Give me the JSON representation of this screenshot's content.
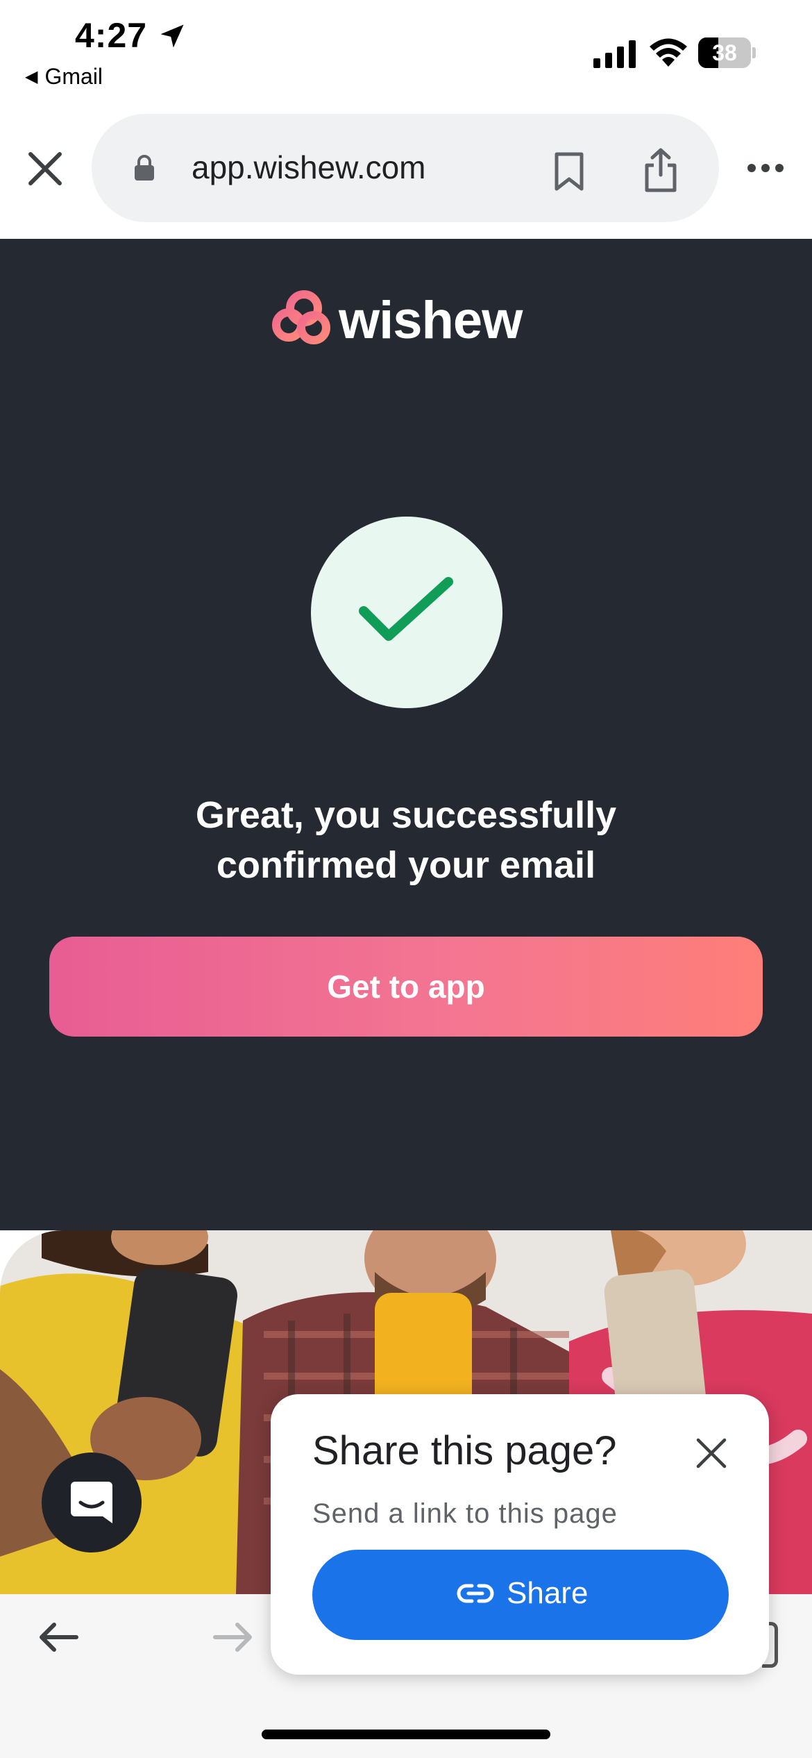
{
  "status_bar": {
    "time": "4:27",
    "back_app": "Gmail",
    "battery": "38",
    "battery_percent": 38
  },
  "browser": {
    "url": "app.wishew.com"
  },
  "page": {
    "brand": "wishew",
    "headline_line1": "Great, you successfully",
    "headline_line2": "confirmed your email",
    "cta_label": "Get to app"
  },
  "share_popup": {
    "title": "Share this page?",
    "subtitle": "Send a link to this page",
    "button_label": "Share"
  },
  "colors": {
    "page_bg": "#252932",
    "cta_gradient_start": "#e85d93",
    "cta_gradient_end": "#fe7e79",
    "check_green": "#0f9d58",
    "share_button": "#1a73e8"
  },
  "icons": [
    "location-arrow-icon",
    "signal-icon",
    "wifi-icon",
    "battery-icon",
    "close-icon",
    "lock-icon",
    "bookmark-icon",
    "share-icon",
    "more-icon",
    "checkmark-icon",
    "chat-icon",
    "back-arrow-icon",
    "forward-arrow-icon",
    "link-icon"
  ]
}
